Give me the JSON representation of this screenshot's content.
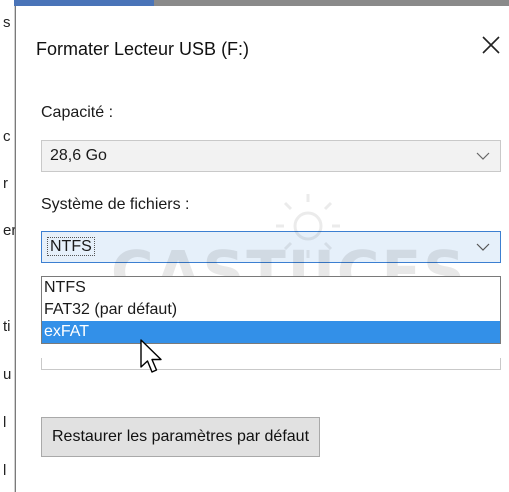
{
  "dialog": {
    "title": "Formater Lecteur USB (F:)",
    "close_glyph": "✕"
  },
  "capacity": {
    "label": "Capacité :",
    "value": "28,6 Go"
  },
  "filesystem": {
    "label": "Système de fichiers :",
    "value": "NTFS",
    "options": [
      "NTFS",
      "FAT32 (par défaut)",
      "exFAT"
    ],
    "highlighted": "exFAT"
  },
  "restore_button": "Restaurer les paramètres par défaut",
  "watermark": "CASTUCES",
  "background_fragments": [
    "s",
    "c",
    "r",
    "er",
    "ti",
    "u",
    "l",
    "l"
  ],
  "colors": {
    "highlight": "#3390e8",
    "combo_focus_bg": "#e6f0fa",
    "combo_focus_border": "#3c7fd1"
  },
  "icons": {
    "close": "close-icon",
    "dropdown": "chevron-down-icon",
    "cursor": "mouse-pointer-icon"
  }
}
